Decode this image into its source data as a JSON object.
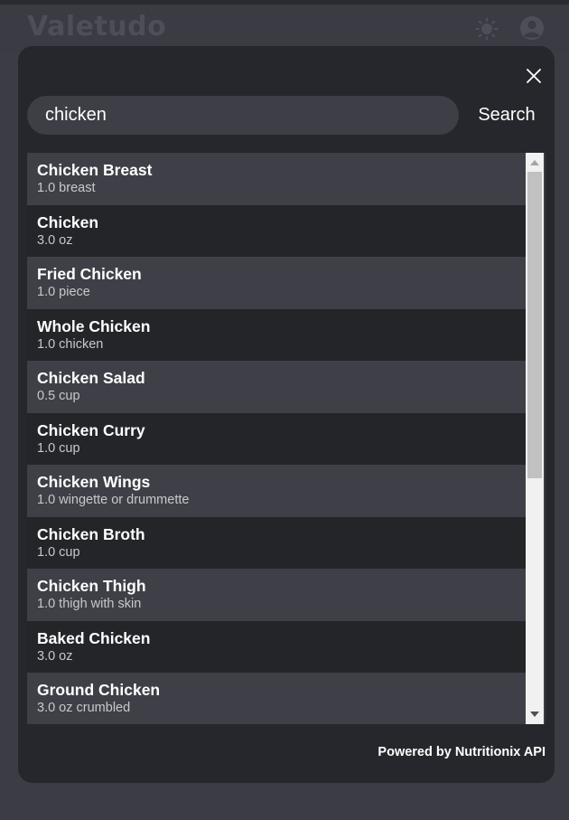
{
  "app": {
    "title": "Valetudo"
  },
  "header": {
    "theme_icon": "sun-icon",
    "account_icon": "account-circle-icon"
  },
  "search": {
    "value": "chicken",
    "placeholder": "",
    "button_label": "Search"
  },
  "results": [
    {
      "name": "Chicken Breast",
      "serving": "1.0 breast"
    },
    {
      "name": "Chicken",
      "serving": "3.0 oz"
    },
    {
      "name": "Fried Chicken",
      "serving": "1.0 piece"
    },
    {
      "name": "Whole Chicken",
      "serving": "1.0 chicken"
    },
    {
      "name": "Chicken Salad",
      "serving": "0.5 cup"
    },
    {
      "name": "Chicken Curry",
      "serving": "1.0 cup"
    },
    {
      "name": "Chicken Wings",
      "serving": "1.0 wingette or drummette"
    },
    {
      "name": "Chicken Broth",
      "serving": "1.0 cup"
    },
    {
      "name": "Chicken Thigh",
      "serving": "1.0 thigh with skin"
    },
    {
      "name": "Baked Chicken",
      "serving": "3.0 oz"
    },
    {
      "name": "Ground Chicken",
      "serving": "3.0 oz crumbled"
    }
  ],
  "footer": {
    "attribution": "Powered by Nutritionix API"
  },
  "colors": {
    "background": "#3b3c44",
    "modal": "#26272c",
    "row_light": "#3f4047",
    "row_dark": "#242529",
    "text": "#ffffff",
    "subtext": "#c8c8cc"
  }
}
